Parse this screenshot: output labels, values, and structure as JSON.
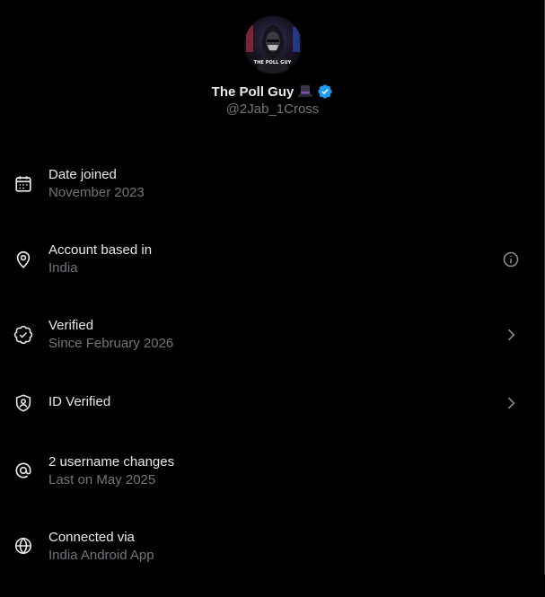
{
  "profile": {
    "display_name": "The Poll Guy",
    "name_emoji": "top-hat-emoji",
    "verified": true,
    "handle": "@2Jab_1Cross",
    "avatar_label": "THE POLL GUY"
  },
  "colors": {
    "background": "#000000",
    "primary_text": "#e7e9ea",
    "secondary_text": "#71767b",
    "verified_blue": "#1d9bf0"
  },
  "rows": [
    {
      "icon": "calendar-icon",
      "title": "Date joined",
      "subtitle": "November 2023",
      "action": null
    },
    {
      "icon": "location-pin-icon",
      "title": "Account based in",
      "subtitle": "India",
      "action": "info-icon"
    },
    {
      "icon": "verified-outline-icon",
      "title": "Verified",
      "subtitle": "Since February 2026",
      "action": "chevron-right-icon"
    },
    {
      "icon": "id-shield-icon",
      "title": "ID Verified",
      "subtitle": "",
      "action": "chevron-right-icon"
    },
    {
      "icon": "at-sign-icon",
      "title": "2 username changes",
      "subtitle": "Last on May 2025",
      "action": null
    },
    {
      "icon": "globe-icon",
      "title": "Connected via",
      "subtitle": "India Android App",
      "action": null
    }
  ]
}
